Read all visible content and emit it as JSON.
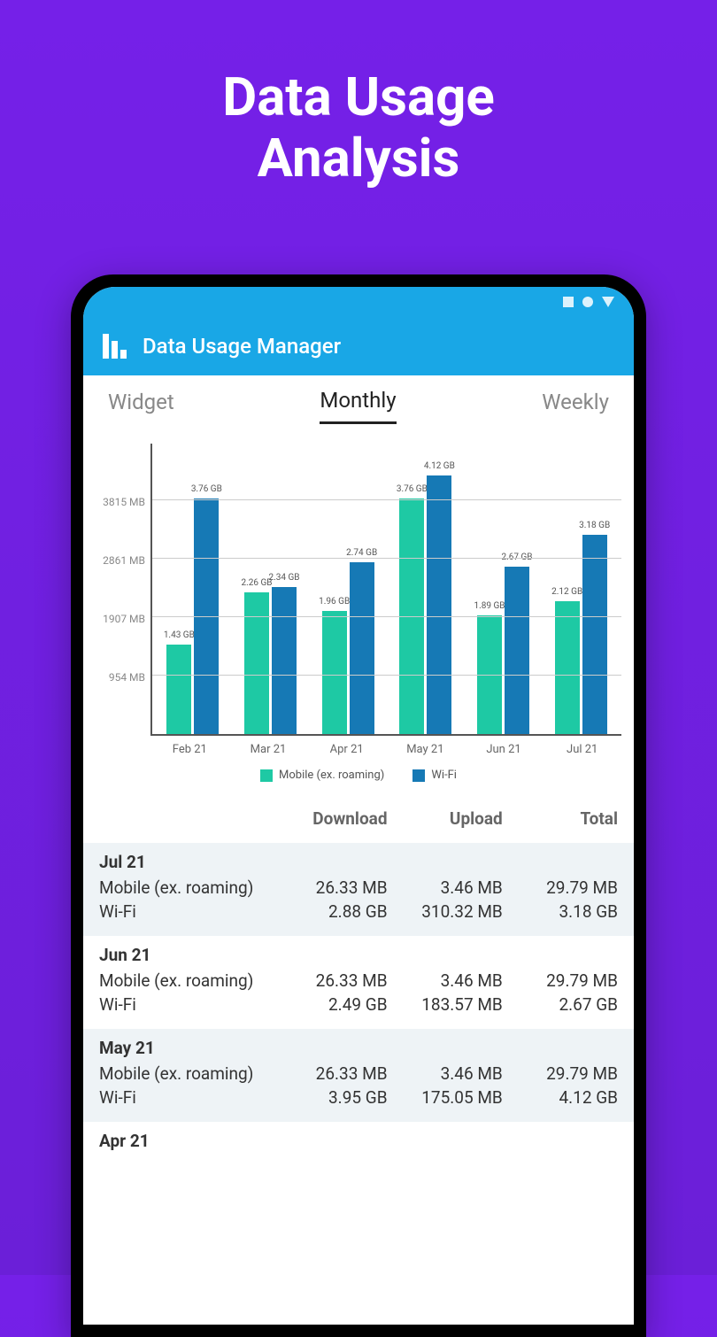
{
  "hero": {
    "line1": "Data Usage",
    "line2": "Analysis"
  },
  "app": {
    "title": "Data Usage Manager"
  },
  "tabs": {
    "widget": "Widget",
    "monthly": "Monthly",
    "weekly": "Weekly"
  },
  "legend": {
    "mobile": "Mobile (ex. roaming)",
    "wifi": "Wi-Fi"
  },
  "table_headers": {
    "download": "Download",
    "upload": "Upload",
    "total": "Total"
  },
  "colors": {
    "mobile": "#1EC9A4",
    "wifi": "#1679B5",
    "accent": "#19A7E6"
  },
  "chart_data": {
    "type": "bar",
    "title": "",
    "xlabel": "",
    "ylabel": "",
    "ylim": [
      0,
      4769
    ],
    "y_ticks": [
      "954 MB",
      "1907 MB",
      "2861 MB",
      "3815 MB"
    ],
    "y_tick_values": [
      954,
      1907,
      2861,
      3815
    ],
    "categories": [
      "Feb 21",
      "Mar 21",
      "Apr 21",
      "May 21",
      "Jun 21",
      "Jul 21"
    ],
    "series": [
      {
        "name": "Mobile (ex. roaming)",
        "values_gb": [
          1.43,
          2.26,
          1.96,
          3.76,
          1.89,
          2.12
        ],
        "labels": [
          "1.43 GB",
          "2.26 GB",
          "1.96 GB",
          "3.76 GB",
          "1.89 GB",
          "2.12 GB"
        ]
      },
      {
        "name": "Wi-Fi",
        "values_gb": [
          3.76,
          2.34,
          2.74,
          4.12,
          2.67,
          3.18
        ],
        "labels": [
          "3.76 GB",
          "2.34 GB",
          "2.74 GB",
          "4.12 GB",
          "2.67 GB",
          "3.18 GB"
        ]
      }
    ]
  },
  "table": [
    {
      "month": "Jul 21",
      "rows": [
        {
          "label": "Mobile (ex. roaming)",
          "download": "26.33 MB",
          "upload": "3.46 MB",
          "total": "29.79 MB"
        },
        {
          "label": "Wi-Fi",
          "download": "2.88 GB",
          "upload": "310.32 MB",
          "total": "3.18 GB"
        }
      ]
    },
    {
      "month": "Jun 21",
      "rows": [
        {
          "label": "Mobile (ex. roaming)",
          "download": "26.33 MB",
          "upload": "3.46 MB",
          "total": "29.79 MB"
        },
        {
          "label": "Wi-Fi",
          "download": "2.49 GB",
          "upload": "183.57 MB",
          "total": "2.67 GB"
        }
      ]
    },
    {
      "month": "May 21",
      "rows": [
        {
          "label": "Mobile (ex. roaming)",
          "download": "26.33 MB",
          "upload": "3.46 MB",
          "total": "29.79 MB"
        },
        {
          "label": "Wi-Fi",
          "download": "3.95 GB",
          "upload": "175.05 MB",
          "total": "4.12 GB"
        }
      ]
    },
    {
      "month": "Apr 21",
      "rows": []
    }
  ]
}
